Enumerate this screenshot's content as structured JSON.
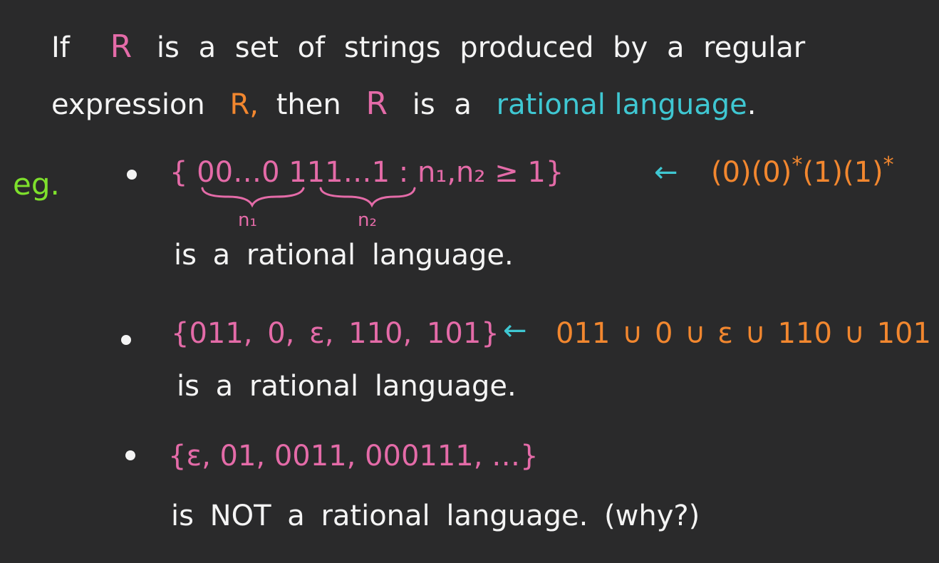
{
  "intro": {
    "line1": {
      "if": "If",
      "r": "R",
      "rest": "is a set of strings produced by a regular"
    },
    "line2": {
      "expression": "expression",
      "r_expr": "R,",
      "then": "then",
      "r": "R",
      "is_a": "is a",
      "rational_language": "rational language",
      "period": "."
    }
  },
  "eg_label": "eg.",
  "example1": {
    "set_open": "{",
    "zeros": "00…0",
    "ones": "111…1",
    "condition": ": n₁,n₂ ≥ 1}",
    "arrow": "←",
    "regex": "(0)(0)",
    "regex_star1": "*",
    "regex2": "(1)(1)",
    "regex_star2": "*",
    "n1_label": "n₁",
    "n2_label": "n₂",
    "statement": "is a rational language."
  },
  "example2": {
    "set": "{011, 0, ε, 110, 101}",
    "arrow": "←",
    "union": "011 ∪ 0 ∪ ε ∪ 110 ∪ 101",
    "statement": "is a rational language."
  },
  "example3": {
    "set": "{ε, 01, 0011, 000111, …}",
    "statement": "is NOT a rational language.  (why?)"
  },
  "colors": {
    "background": "#2a2a2b",
    "text": "#f4f4f4",
    "pink": "#e46ba8",
    "orange": "#f2872f",
    "cyan": "#3fc7d2",
    "green": "#7ee02c"
  }
}
